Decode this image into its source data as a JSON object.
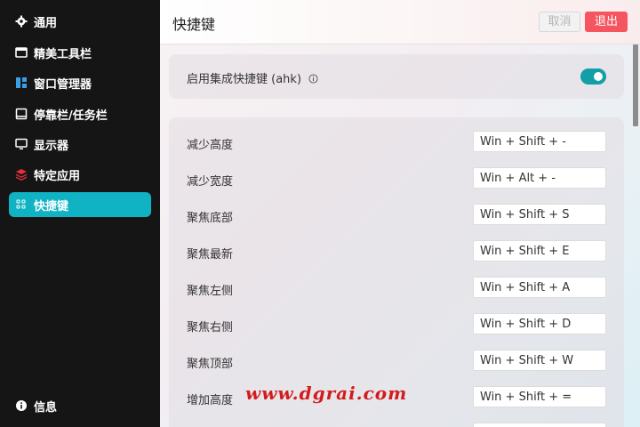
{
  "sidebar": {
    "items": [
      {
        "label": "通用",
        "icon": "gear-icon"
      },
      {
        "label": "精美工具栏",
        "icon": "window-icon"
      },
      {
        "label": "窗口管理器",
        "icon": "layout-icon"
      },
      {
        "label": "停靠栏/任务栏",
        "icon": "dock-icon"
      },
      {
        "label": "显示器",
        "icon": "monitor-icon"
      },
      {
        "label": "特定应用",
        "icon": "layers-icon"
      },
      {
        "label": "快捷键",
        "icon": "keyboard-icon"
      }
    ],
    "info_label": "信息",
    "active_color": "#10b3c4"
  },
  "header": {
    "title": "快捷键",
    "cancel_label": "取消",
    "exit_label": "退出"
  },
  "toggle_card": {
    "label": "启用集成快捷键 (ahk)",
    "enabled": true
  },
  "shortcuts": [
    {
      "label": "减少高度",
      "value": "Win + Shift + -"
    },
    {
      "label": "减少宽度",
      "value": "Win + Alt + -"
    },
    {
      "label": "聚焦底部",
      "value": "Win + Shift + S"
    },
    {
      "label": "聚焦最新",
      "value": "Win + Shift + E"
    },
    {
      "label": "聚焦左侧",
      "value": "Win + Shift + A"
    },
    {
      "label": "聚焦右侧",
      "value": "Win + Shift + D"
    },
    {
      "label": "聚焦顶部",
      "value": "Win + Shift + W"
    },
    {
      "label": "增加高度",
      "value": "Win + Shift + ="
    }
  ],
  "watermark": "www.dgrai.com",
  "colors": {
    "accent": "#10b3c4",
    "toggle": "#139fa6",
    "exit_button": "#f4555f",
    "sidebar_bg": "#151515"
  }
}
